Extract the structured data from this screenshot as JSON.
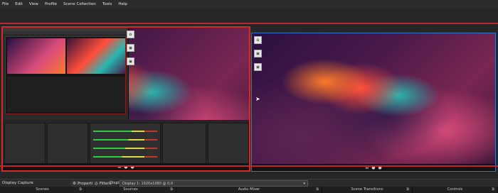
{
  "menu": [
    "File",
    "Edit",
    "View",
    "Profile",
    "Scene Collection",
    "Tools",
    "Help"
  ],
  "status": {
    "source_label": "Display Capture",
    "properties_label": "Properties",
    "filters_label": "Filters",
    "display_label": "Display",
    "display_value": "Display 1: 1920x1080 @ 0,0"
  },
  "docks": [
    {
      "label": "Scenes",
      "icon": "float-icon"
    },
    {
      "label": "Sources",
      "icon": "float-icon"
    },
    {
      "label": "Audio Mixer",
      "icon": "float-icon"
    },
    {
      "label": "Scene Transitions",
      "icon": "float-icon"
    },
    {
      "label": "Controls",
      "icon": "float-icon"
    }
  ],
  "colors": {
    "accent_red": "#c0272d",
    "selection_blue": "#3a74c9",
    "bg": "#1e1e1e"
  }
}
